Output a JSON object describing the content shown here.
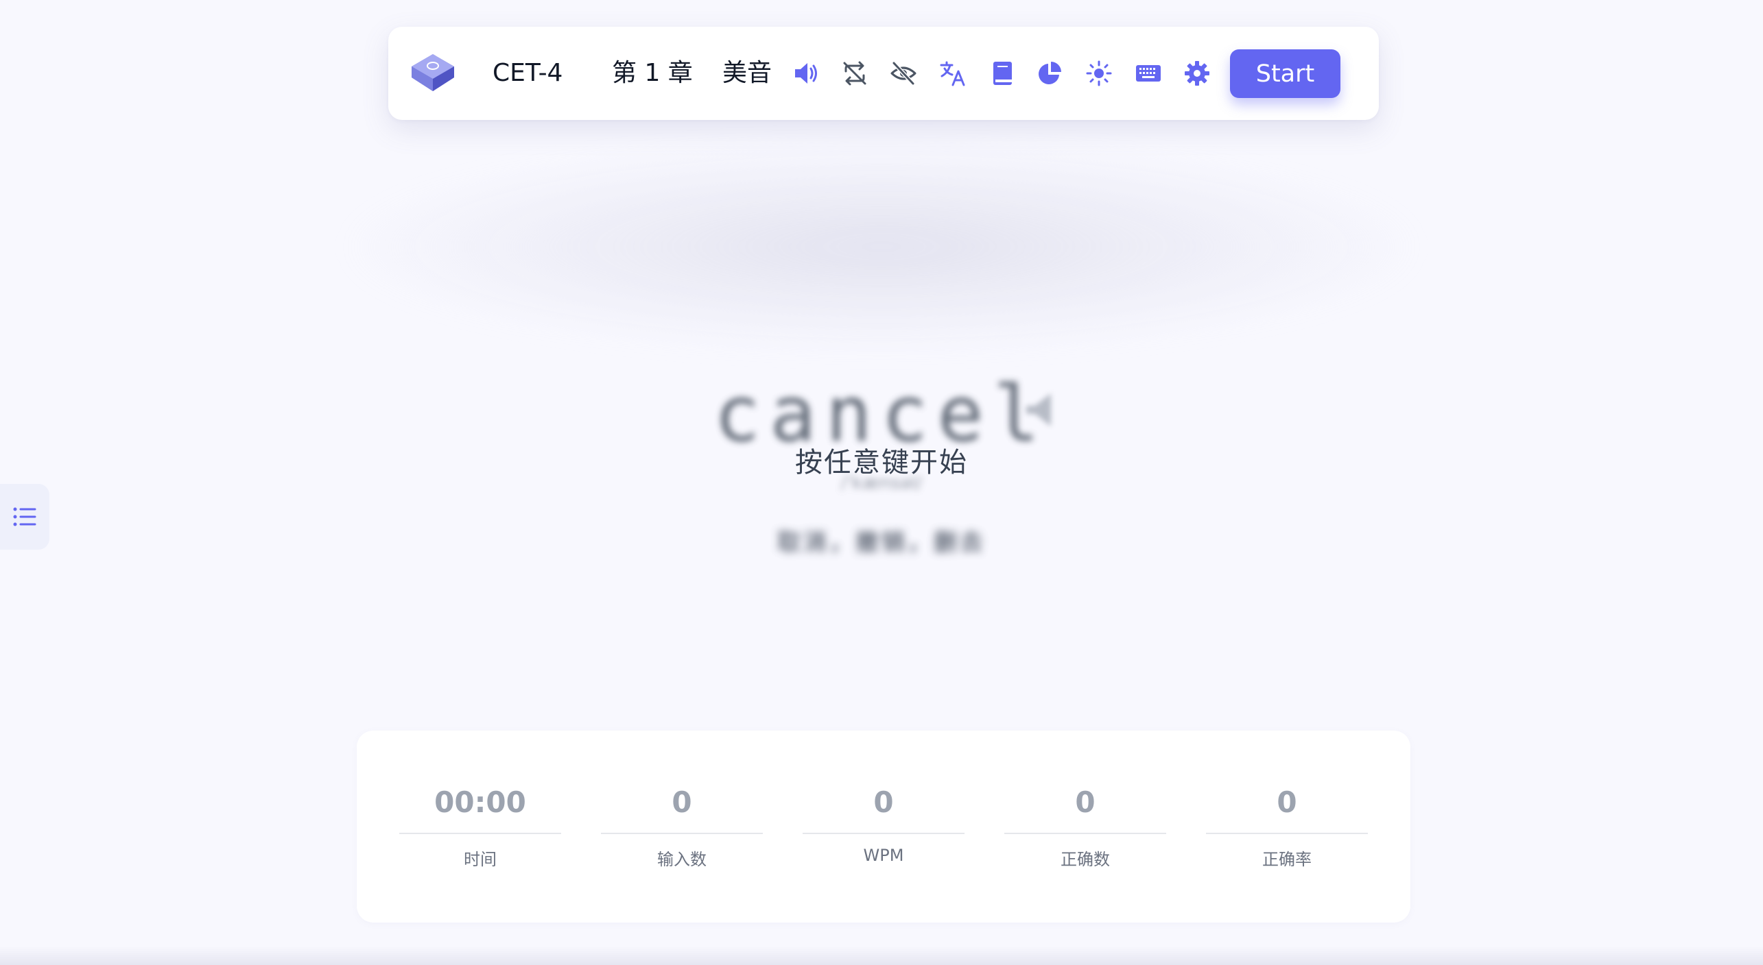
{
  "toolbar": {
    "dict_label": "CET-4",
    "chapter_label": "第 1 章",
    "accent_label": "美音",
    "start_label": "Start",
    "icons": [
      "keyboard-logo-icon",
      "speaker-icon",
      "loop-off-icon",
      "eye-off-icon",
      "translate-icon",
      "book-icon",
      "pie-chart-icon",
      "sun-icon",
      "keyboard-icon",
      "gear-icon"
    ]
  },
  "main": {
    "word": "cancel",
    "hint": "按任意键开始"
  },
  "stats": [
    {
      "value": "00:00",
      "label": "时间"
    },
    {
      "value": "0",
      "label": "输入数"
    },
    {
      "value": "0",
      "label": "WPM"
    },
    {
      "value": "0",
      "label": "正确数"
    },
    {
      "value": "0",
      "label": "正确率"
    }
  ],
  "colors": {
    "accent": "#6366f1",
    "page_bg": "#f8f8fe",
    "muted_value": "#9ca3af",
    "label_gray": "#6b7280",
    "icon_gray": "#4b5563"
  }
}
